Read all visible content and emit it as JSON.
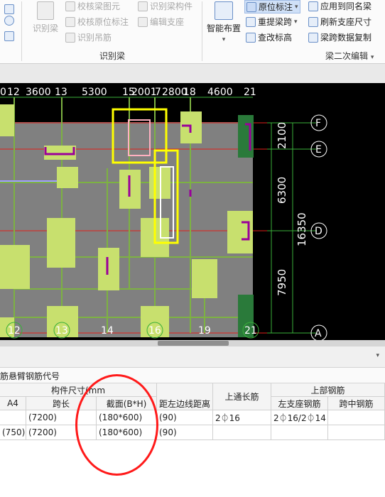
{
  "ribbon": {
    "identify_beam": "识别梁",
    "check_beam_element": "校核梁图元",
    "check_origin_annotation": "校核原位标注",
    "identify_hanger": "识别吊筋",
    "identify_beam_member": "识别梁构件",
    "edit_support": "编辑支座",
    "group_identify": "识别梁",
    "smart_layout": "智能布置",
    "origin_annotation": "原位标注",
    "reextract_span": "重提梁跨",
    "check_annotation_height": "查改标高",
    "apply_same_name": "应用到同名梁",
    "refresh_support_size": "刷新支座尺寸",
    "span_data_copy": "梁跨数据复制",
    "group_secondary_edit": "梁二次编辑"
  },
  "cad": {
    "top_axis_labels": [
      "0",
      "12",
      "3600",
      "13",
      "5300",
      "15",
      "2001",
      "7",
      "2800",
      "18",
      "4600",
      "21"
    ],
    "bottom_axis_labels": [
      "12",
      "13",
      "14",
      "16",
      "19",
      "21"
    ],
    "row_axis_labels": [
      "F",
      "E",
      "D",
      "A"
    ],
    "right_dims": [
      "2100",
      "6300",
      "16350",
      "7950"
    ],
    "colors": {
      "background": "#000000",
      "slab": "#808080",
      "column": "#c8e06e",
      "beam": "#7db242",
      "grid": "#e0201a",
      "dim": "#3ab03a",
      "support": "#9a009a",
      "selected": "#ffff00"
    }
  },
  "panel": {
    "tabs_text": "悬臂钢筋代号",
    "tabs_prefix": "筋",
    "header_group_size": "构件尺寸(mm",
    "header_top_rebar": "上部钢筋",
    "col_a4": "A4",
    "col_span_length": "跨长",
    "col_section": "截面(B*H)",
    "col_left_edge_distance": "距左边线距离",
    "col_top_through": "上通长筋",
    "col_left_support": "左支座钢筋",
    "col_mid_span": "跨中钢筋",
    "rows": [
      {
        "a4": "",
        "span": "(7200)",
        "section": "(180*600)",
        "edge": "(90)",
        "top_through": "2⏀16",
        "left_support": "2⏀16/2⏀14",
        "mid": ""
      },
      {
        "a4": "(750)",
        "span": "(7200)",
        "section": "(180*600)",
        "edge": "(90)",
        "top_through": "",
        "left_support": "",
        "mid": ""
      }
    ]
  }
}
